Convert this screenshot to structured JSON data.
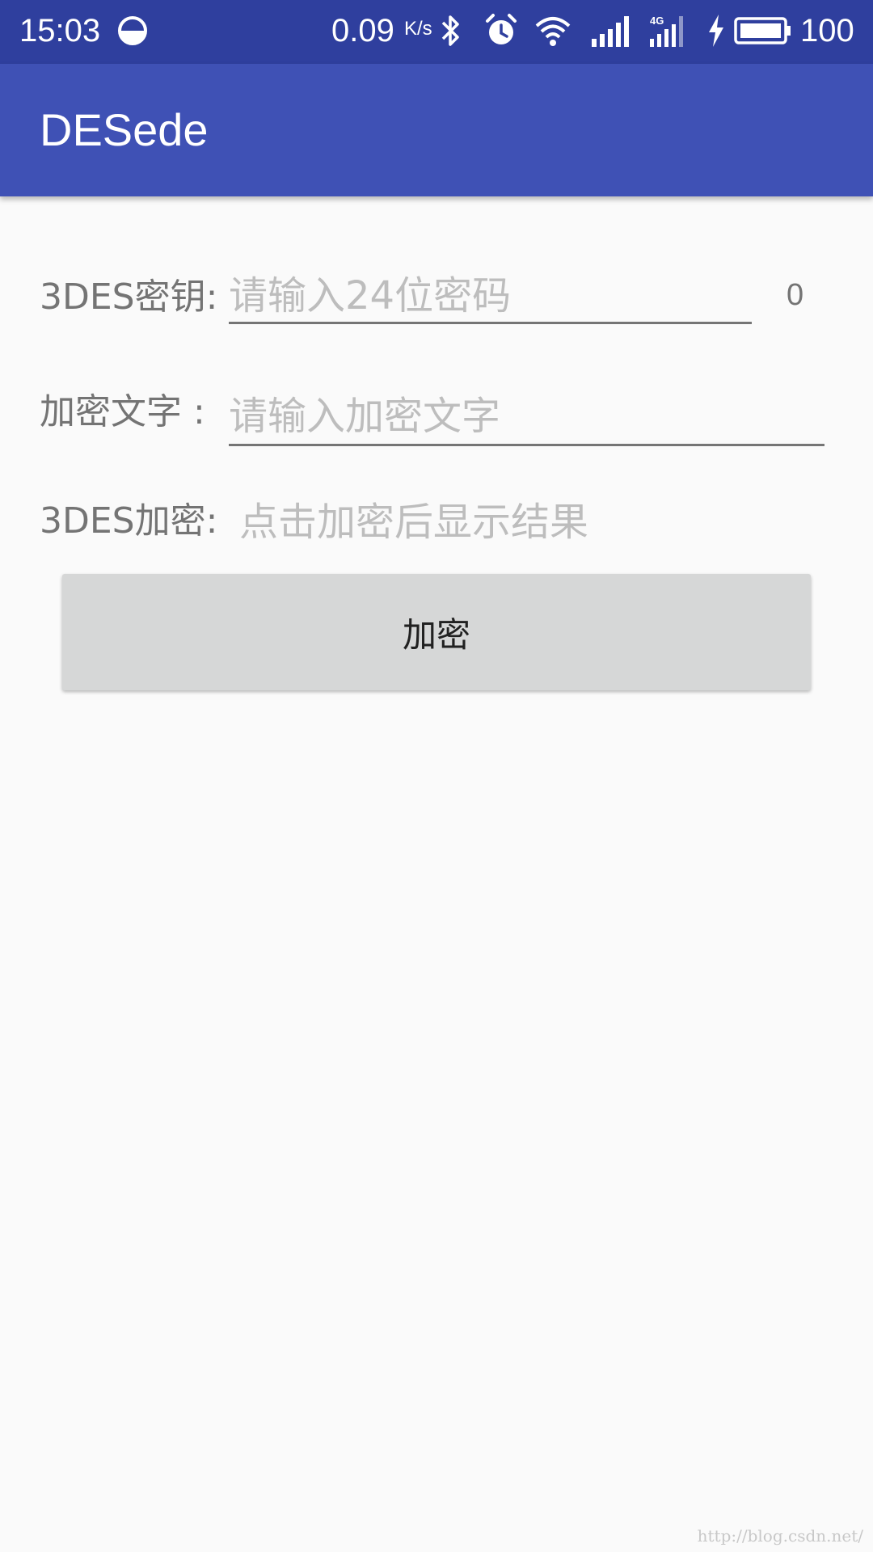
{
  "status_bar": {
    "time": "15:03",
    "net_speed": "0.09",
    "net_speed_unit": "K/s",
    "network_type": "4G",
    "battery_level": "100",
    "icons": [
      "data-saver-icon",
      "bluetooth-icon",
      "alarm-clock-icon",
      "wifi-icon",
      "signal-icon",
      "signal-4g-icon",
      "charging-icon",
      "battery-icon"
    ]
  },
  "app_bar": {
    "title": "DESede",
    "color": "#3f51b5",
    "status_color": "#2f3f9e"
  },
  "form": {
    "key_label": "3DES密钥:",
    "key_placeholder": "请输入24位密码",
    "key_value": "",
    "key_counter": "0",
    "text_label": "加密文字 :",
    "text_placeholder": "请输入加密文字",
    "text_value": "",
    "result_label": "3DES加密:",
    "result_hint": "点击加密后显示结果"
  },
  "button": {
    "label": "加密"
  },
  "watermark": "http://blog.csdn.net/"
}
